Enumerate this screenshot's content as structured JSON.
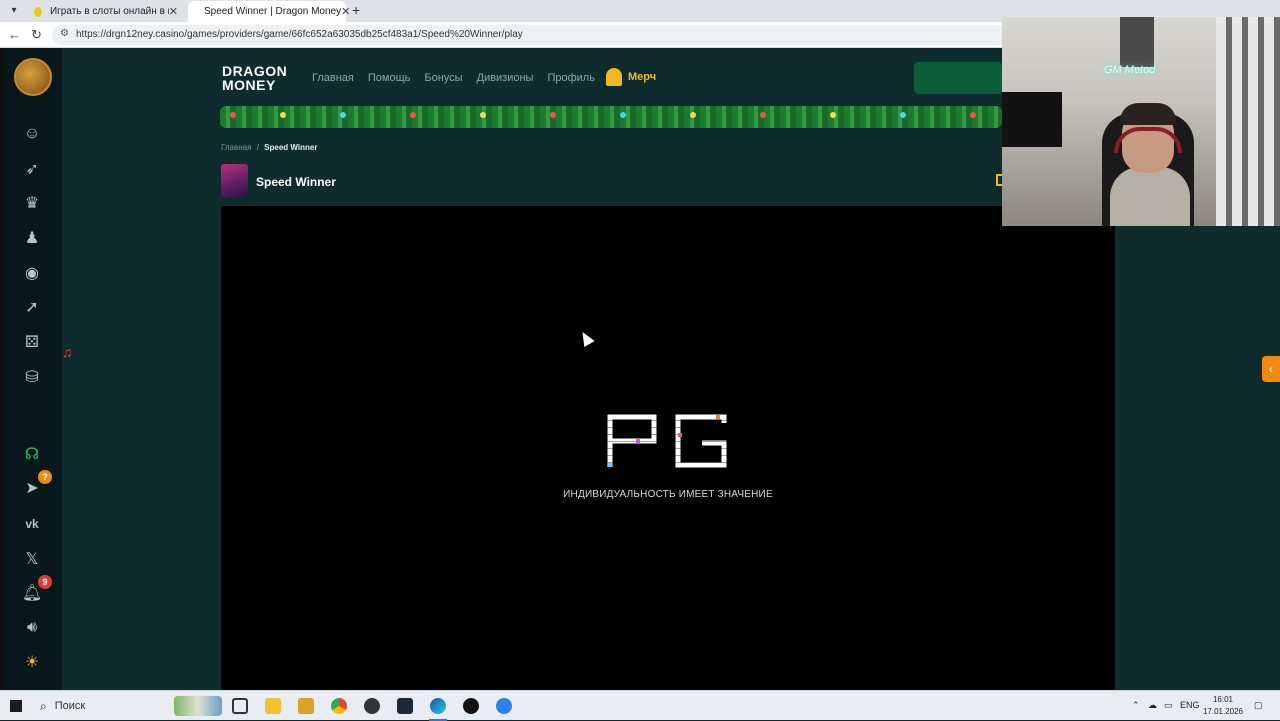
{
  "browser": {
    "tabs": [
      {
        "title": "Играть в слоты онлайн в казино"
      },
      {
        "title": "Speed Winner | Dragon Money"
      }
    ],
    "url": "https://drgn12ney.casino/games/providers/game/66fc652a63035db25cf483a1/Speed%20Winner/play"
  },
  "site": {
    "brand_line1": "DRAGON",
    "brand_line2": "MONEY",
    "menu": [
      "Главная",
      "Помощь",
      "Бонусы",
      "Дивизионы",
      "Профиль"
    ],
    "merch_label": "Мерч",
    "breadcrumb": {
      "home": "Главная",
      "separator": "/",
      "current": "Speed Winner"
    },
    "game_title": "Speed Winner",
    "sidebar_icons": [
      "smiley-icon",
      "rocket-icon",
      "trophy-icon",
      "user-icon",
      "joystick-icon",
      "rocket2-icon",
      "dice-icon",
      "basket-icon",
      "support-icon",
      "telegram-icon",
      "vk-icon",
      "x-icon",
      "bell-icon",
      "sound-icon",
      "sun-icon"
    ],
    "badges": {
      "telegram": "?",
      "bell": "9"
    }
  },
  "game": {
    "provider_logo": "PG",
    "tagline": "ИНДИВИДУАЛЬНОСТЬ ИМЕЕТ ЗНАЧЕНИЕ"
  },
  "webcam": {
    "neon_text": "GM Metod"
  },
  "taskbar": {
    "search_placeholder": "Поиск",
    "language": "ENG",
    "time": "16:01",
    "date": "17.01.2026"
  }
}
